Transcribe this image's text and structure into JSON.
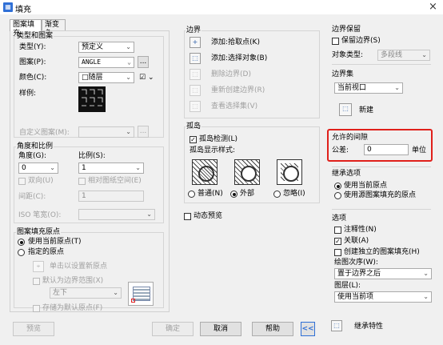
{
  "window": {
    "title": "填充",
    "close": "×",
    "app_icon": "hatch-app-icon"
  },
  "tabs": [
    {
      "label": "图案填充"
    },
    {
      "label": "渐变色"
    }
  ],
  "type_pattern": {
    "group_label": "类型和图案",
    "type_label": "类型(Y):",
    "type_value": "预定义",
    "pattern_label": "图案(P):",
    "pattern_value": "ANGLE",
    "pattern_more": "...",
    "color_label": "颜色(C):",
    "color_value": "□随层",
    "color_extra": "☑",
    "sample_label": "样例:",
    "custom_label": "自定义图案(M):",
    "custom_more": "..."
  },
  "angle_scale": {
    "group_label": "角度和比例",
    "angle_label": "角度(G):",
    "angle_value": "0",
    "scale_label": "比例(S):",
    "scale_value": "1",
    "double_label": "双向(U)",
    "relative_label": "相对图纸空间(E)",
    "spacing_label": "间距(C):",
    "spacing_value": "1",
    "iso_label": "ISO 笔宽(O):"
  },
  "origin": {
    "group_label": "图案填充原点",
    "use_current": "使用当前原点(T)",
    "specified": "指定的原点",
    "click_set": "单击以设置新原点",
    "default_extent": "默认为边界范围(X)",
    "extent_value": "左下",
    "store_default": "存储为默认原点(F)"
  },
  "boundaries": {
    "group_label": "边界",
    "add_pick": "添加:拾取点(K)",
    "add_select": "添加:选择对象(B)",
    "remove": "删除边界(D)",
    "recreate": "重新创建边界(R)",
    "view": "查看选择集(V)"
  },
  "islands": {
    "group_label": "孤岛",
    "detect": "孤岛检测(L)",
    "style_label": "孤岛显示样式:",
    "normal": "普通(N)",
    "outer": "外部",
    "ignore": "忽略(I)"
  },
  "dynamic_preview": "动态预览",
  "boundary_keep": {
    "group_label": "边界保留",
    "keep": "保留边界(S)",
    "object_type_label": "对象类型:",
    "object_type_value": "多段线"
  },
  "boundary_set": {
    "group_label": "边界集",
    "value": "当前视口",
    "new": "新建"
  },
  "gap": {
    "group_label": "允许的间隙",
    "tolerance_label": "公差:",
    "tolerance_value": "0",
    "unit": "单位",
    "highlight_color": "#e0201b"
  },
  "inherit_options": {
    "group_label": "继承选项",
    "use_current": "使用当前原点",
    "use_source": "使用源图案填充的原点"
  },
  "options": {
    "group_label": "选项",
    "annotative": "注释性(N)",
    "associative": "关联(A)",
    "separate": "创建独立的图案填充(H)",
    "draw_order_label": "绘图次序(W):",
    "draw_order_value": "置于边界之后",
    "layer_label": "图层(L):",
    "layer_value": "使用当前项"
  },
  "inherit": "继承特性",
  "footer": {
    "preview": "预览",
    "ok": "确定",
    "cancel": "取消",
    "help": "帮助",
    "collapse": "<<"
  }
}
